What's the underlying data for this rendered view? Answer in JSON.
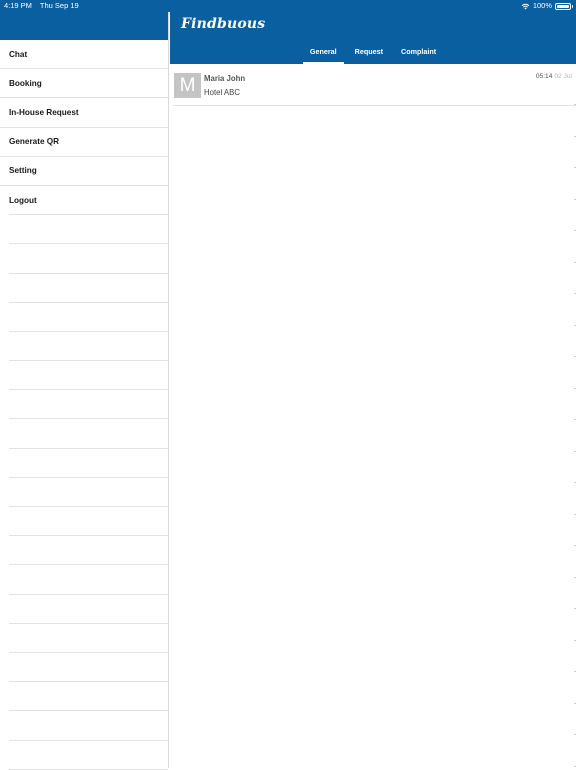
{
  "status_bar": {
    "time": "4:19 PM",
    "date": "Thu Sep 19",
    "battery": "100%",
    "battery_level": 1.0,
    "wifi_icon": "wifi-icon"
  },
  "sidebar": {
    "items": [
      {
        "label": "Chat"
      },
      {
        "label": "Booking"
      },
      {
        "label": "In-House Request"
      },
      {
        "label": "Generate QR"
      },
      {
        "label": "Setting"
      },
      {
        "label": "Logout"
      }
    ]
  },
  "header": {
    "logo": "Findbuous"
  },
  "tabs": [
    {
      "label": "General",
      "active": true
    },
    {
      "label": "Request",
      "active": false
    },
    {
      "label": "Complaint",
      "active": false
    }
  ],
  "chats": [
    {
      "avatar_letter": "M",
      "name": "Maria John",
      "subtitle": "Hotel ABC",
      "time": "05:14",
      "date": "02 Jul"
    }
  ],
  "colors": {
    "brand": "#0a5fa1",
    "divider": "#e3e3e3",
    "avatar_bg": "#c4c4c4"
  }
}
